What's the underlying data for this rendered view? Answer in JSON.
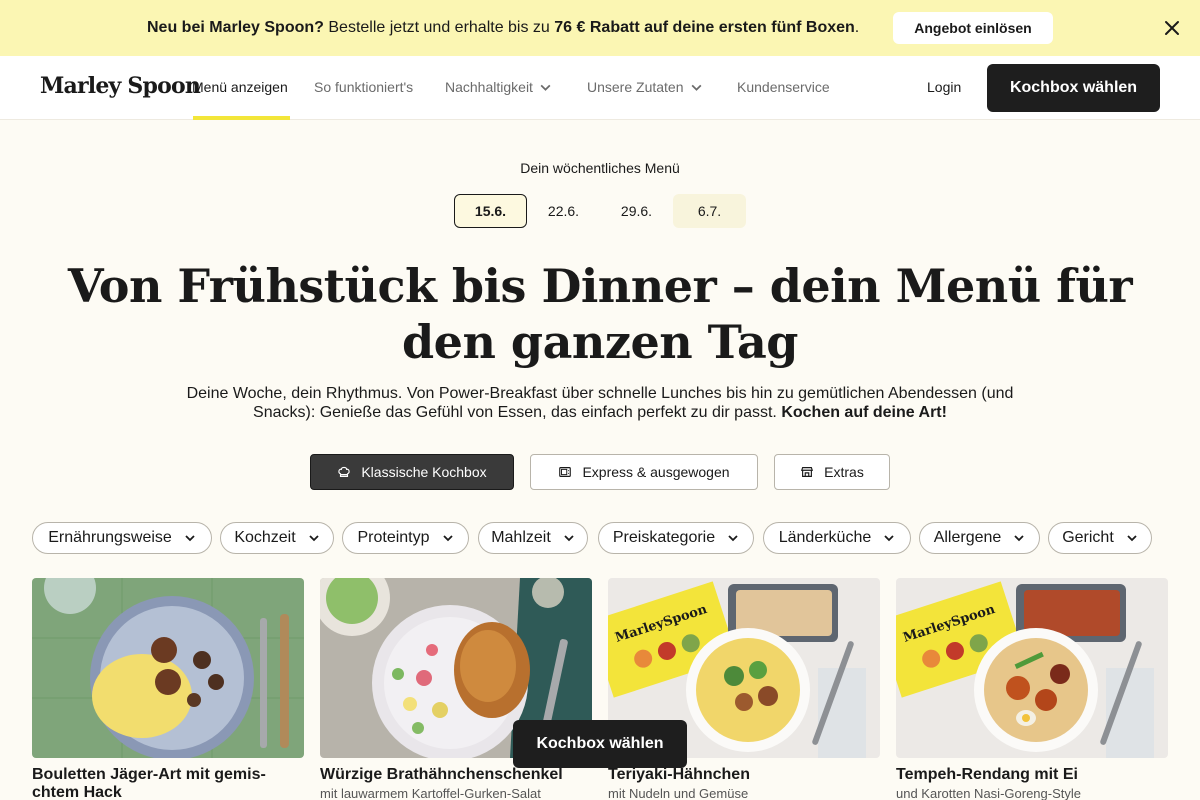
{
  "promo": {
    "bold_lead": "Neu bei Marley Spoon?",
    "text": " Bestelle jetzt und erhalte bis zu ",
    "bold_offer": "76 € Rabatt auf deine ersten fünf Boxen",
    "end": ".",
    "button": "Angebot einlösen"
  },
  "nav": {
    "logo": "Marley Spoon",
    "links": [
      {
        "label": "Menü anzeigen"
      },
      {
        "label": "So funktioniert's"
      },
      {
        "label": "Nachhaltigkeit"
      },
      {
        "label": "Unsere Zutaten"
      },
      {
        "label": "Kundenservice"
      }
    ],
    "login": "Login",
    "cta": "Kochbox wählen"
  },
  "weeks": {
    "label": "Dein wöchentliches Menü",
    "items": [
      "15.6.",
      "22.6.",
      "29.6.",
      "6.7."
    ]
  },
  "headline": "Von Frühstück bis Dinner – dein Menü für den ganzen Tag",
  "subtext": {
    "text": "Deine Woche, dein Rhythmus. Von Power-Breakfast über schnelle Lunches bis hin zu gemütlichen Abendessen (und Snacks): Genieße das Gefühl von Essen, das einfach perfekt zu dir passt. ",
    "bold": "Kochen auf deine Art!"
  },
  "box_types": [
    {
      "label": "Klassische Kochbox",
      "icon": "chef-hat-icon"
    },
    {
      "label": "Express & ausgewogen",
      "icon": "microwave-icon"
    },
    {
      "label": "Extras",
      "icon": "store-icon"
    }
  ],
  "filters": [
    "Ernährungsweise",
    "Kochzeit",
    "Proteintyp",
    "Mahlzeit",
    "Preiskategorie",
    "Länderküche",
    "Allergene",
    "Gericht"
  ],
  "recipes": [
    {
      "title": "Bouletten Jäger-Art mit gemis-chtem Hack",
      "subtitle": ""
    },
    {
      "title": "Würzige Brathähnchenschenkel",
      "subtitle": "mit lauwarmem Kartoffel-Gurken-Salat"
    },
    {
      "title": "Teriyaki-Hähnchen",
      "subtitle": "mit Nudeln und Gemüse"
    },
    {
      "title": "Tempeh-Rendang mit Ei",
      "subtitle": "und Karotten Nasi-Goreng-Style"
    }
  ],
  "floating_cta": "Kochbox wählen",
  "colors": {
    "banner": "#fbf6b3",
    "accent_yellow": "#f3e639",
    "page_bg": "#fdfbf4",
    "dark": "#1e1e1e"
  }
}
